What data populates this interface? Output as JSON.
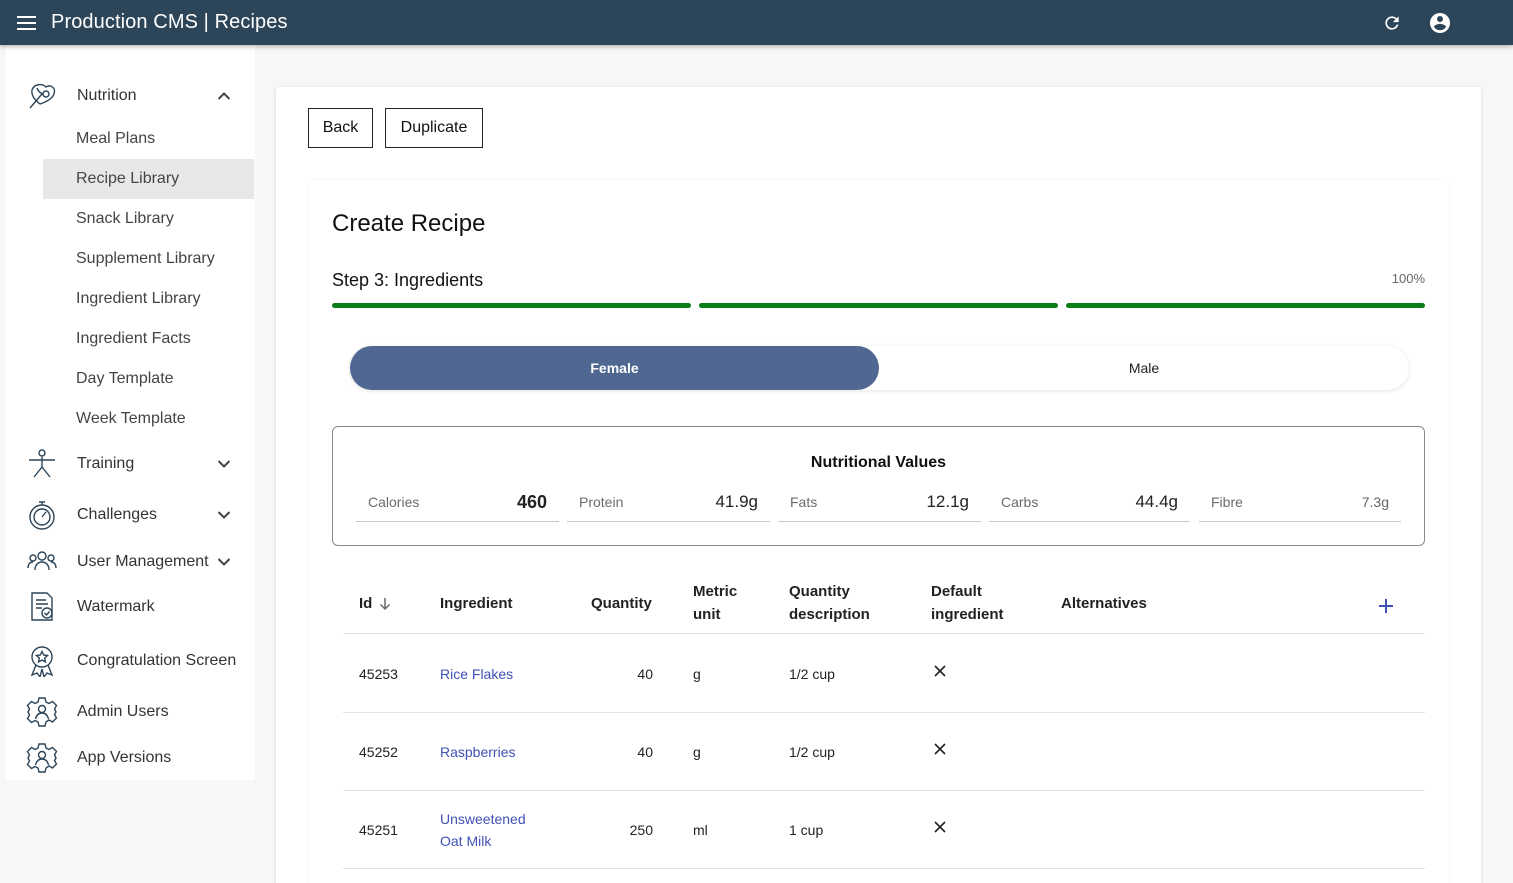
{
  "header": {
    "title": "Production CMS | Recipes",
    "menu_icon": "menu-icon",
    "refresh_icon": "refresh-icon",
    "account_icon": "account-circle-icon"
  },
  "sidebar": {
    "groups": [
      {
        "label": "Nutrition",
        "icon": "nutrition-icon",
        "expanded": true
      },
      {
        "label": "Training",
        "icon": "training-icon",
        "expanded": false
      },
      {
        "label": "Challenges",
        "icon": "challenges-icon",
        "expanded": false
      },
      {
        "label": "User Management",
        "icon": "users-icon",
        "expanded": false
      },
      {
        "label": "Watermark",
        "icon": "watermark-icon"
      },
      {
        "label": "Congratulation Screen",
        "icon": "award-icon"
      },
      {
        "label": "Admin Users",
        "icon": "admin-gear-icon"
      },
      {
        "label": "App Versions",
        "icon": "app-gear-icon"
      }
    ],
    "nutrition_items": [
      {
        "label": "Meal Plans"
      },
      {
        "label": "Recipe Library",
        "active": true
      },
      {
        "label": "Snack Library"
      },
      {
        "label": "Supplement Library"
      },
      {
        "label": "Ingredient Library"
      },
      {
        "label": "Ingredient Facts"
      },
      {
        "label": "Day Template"
      },
      {
        "label": "Week Template"
      }
    ]
  },
  "actions": {
    "back_label": "Back",
    "duplicate_label": "Duplicate"
  },
  "form": {
    "title": "Create Recipe",
    "step_label": "Step 3: Ingredients",
    "progress_percent": "100%",
    "progress_value": 1.0,
    "accent_color": "#0b7d16"
  },
  "gender_toggle": {
    "options": [
      "Female",
      "Male"
    ],
    "selected": "Female",
    "selected_color": "#4f6791"
  },
  "nutrition": {
    "title": "Nutritional Values",
    "fields": [
      {
        "label": "Calories",
        "value": "460"
      },
      {
        "label": "Protein",
        "value": "41.9g"
      },
      {
        "label": "Fats",
        "value": "12.1g"
      },
      {
        "label": "Carbs",
        "value": "44.4g"
      },
      {
        "label": "Fibre",
        "value": "7.3g"
      }
    ]
  },
  "table": {
    "columns": {
      "id": "Id",
      "ingredient": "Ingredient",
      "quantity": "Quantity",
      "metric_unit_1": "Metric",
      "metric_unit_2": "unit",
      "quantity_desc_1": "Quantity",
      "quantity_desc_2": "description",
      "default_ingredient_1": "Default",
      "default_ingredient_2": "ingredient",
      "alternatives": "Alternatives"
    },
    "sort_icon": "arrow-down-icon",
    "add_icon": "plus-icon",
    "rows": [
      {
        "id": "45253",
        "ingredient_1": "Rice Flakes",
        "ingredient_2": "",
        "quantity": "40",
        "unit": "g",
        "description": "1/2 cup",
        "default_icon": "close-icon"
      },
      {
        "id": "45252",
        "ingredient_1": "Raspberries",
        "ingredient_2": "",
        "quantity": "40",
        "unit": "g",
        "description": "1/2 cup",
        "default_icon": "close-icon"
      },
      {
        "id": "45251",
        "ingredient_1": "Unsweetened",
        "ingredient_2": "Oat Milk",
        "quantity": "250",
        "unit": "ml",
        "description": "1 cup",
        "default_icon": "close-icon"
      }
    ]
  }
}
